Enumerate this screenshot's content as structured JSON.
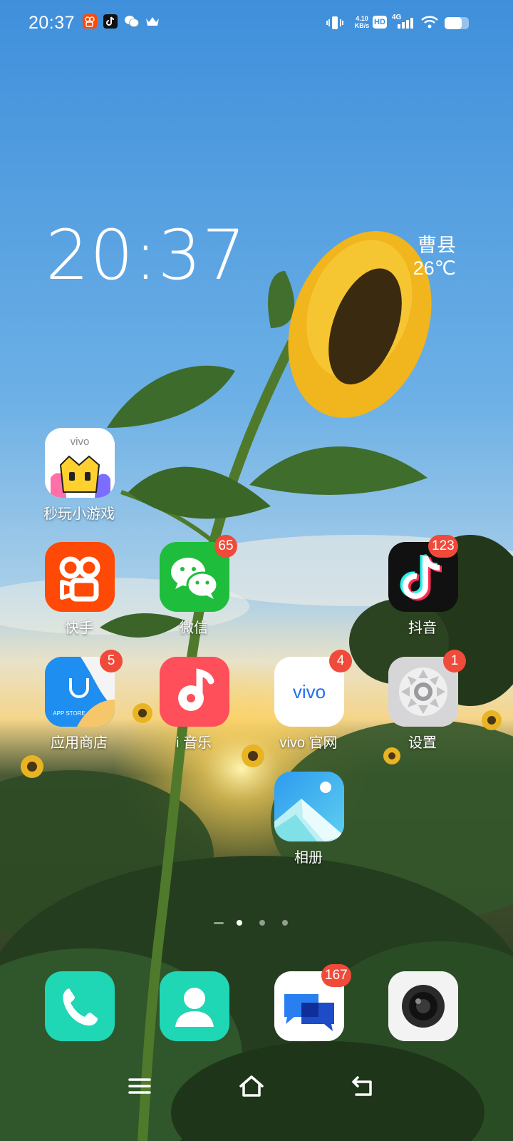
{
  "status_bar": {
    "time": "20:37",
    "network_speed_value": "4.10",
    "network_speed_unit": "KB/s",
    "hd_label": "HD",
    "network_type": "4G",
    "notification_icons": [
      "kuaishou-icon",
      "douyin-icon",
      "wechat-icon",
      "crown-icon"
    ],
    "battery_level": 0.7
  },
  "clock_widget": {
    "time": "20:37",
    "city": "曹县",
    "temperature": "26℃"
  },
  "apps": [
    {
      "id": "mini-games",
      "label": "秒玩小游戏",
      "badge": ""
    },
    {
      "id": "kuaishou",
      "label": "快手",
      "badge": ""
    },
    {
      "id": "wechat",
      "label": "微信",
      "badge": "65"
    },
    {
      "id": "douyin",
      "label": "抖音",
      "badge": "123"
    },
    {
      "id": "app-store",
      "label": "应用商店",
      "badge": "5"
    },
    {
      "id": "i-music",
      "label": "i 音乐",
      "badge": ""
    },
    {
      "id": "vivo-official",
      "label": "vivo 官网",
      "badge": "4"
    },
    {
      "id": "settings",
      "label": "设置",
      "badge": "1"
    },
    {
      "id": "gallery",
      "label": "相册",
      "badge": ""
    }
  ],
  "dock": [
    {
      "id": "phone",
      "badge": ""
    },
    {
      "id": "contacts",
      "badge": ""
    },
    {
      "id": "messages",
      "badge": "167"
    },
    {
      "id": "camera",
      "badge": ""
    }
  ],
  "icon_texts": {
    "vivo_mini": "vivo",
    "app_store": "APP STORE",
    "vivo_site": "vivo"
  },
  "pages": {
    "count": 3,
    "current": 1
  },
  "nav": [
    "menu-icon",
    "home-icon",
    "back-icon"
  ],
  "colors": {
    "badge": "#f04a3a",
    "kuaishou": "#ff4906",
    "wechat": "#1ebd3c",
    "sky_top": "#3d8fdc",
    "dock_teal": "#1fd8b6"
  }
}
